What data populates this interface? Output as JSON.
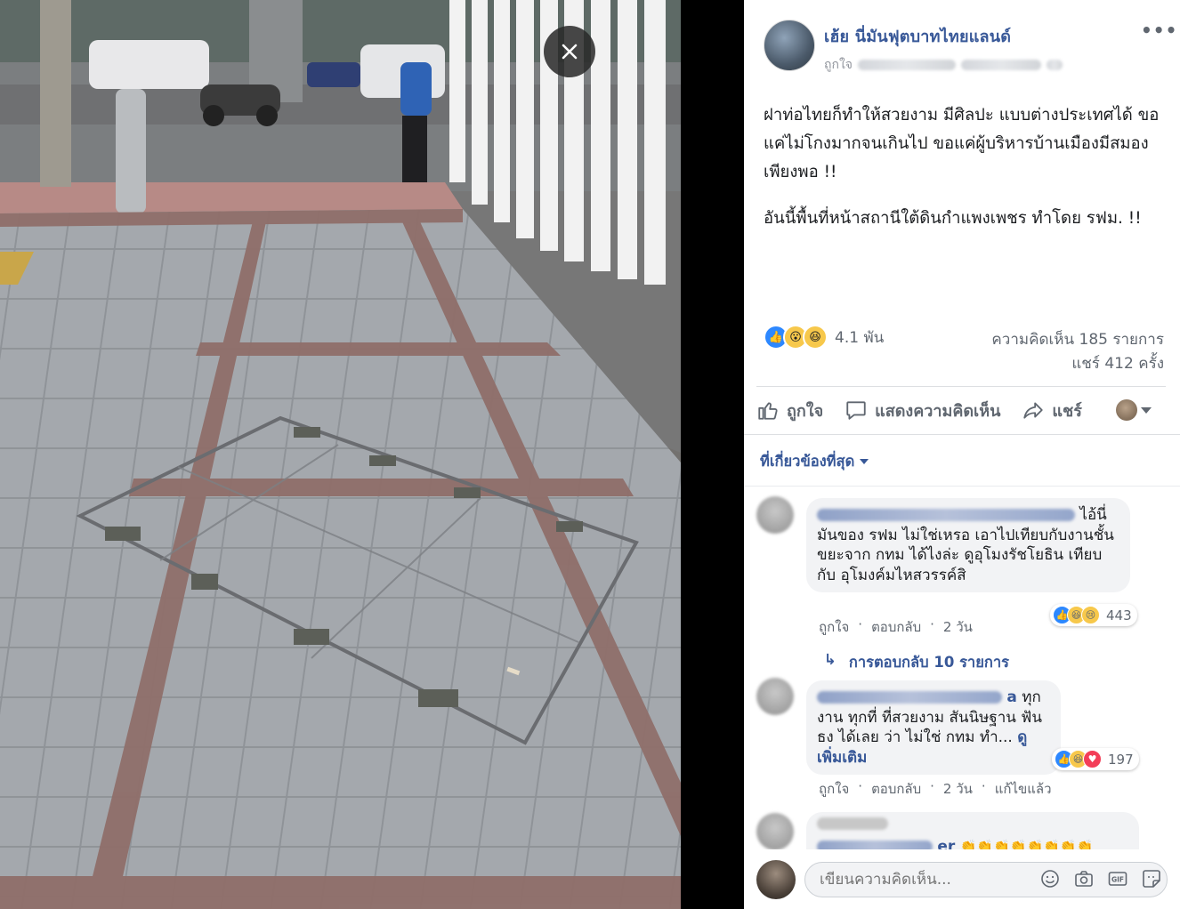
{
  "photo": {
    "close_icon": "close-icon"
  },
  "post": {
    "page_name": "เฮ้ย นี่มันฟุตบาทไทยแลนด์",
    "like_label": "ถูกใจ",
    "more_icon": "more-icon",
    "more_label": "•••",
    "text_paragraphs": [
      "ฝาท่อไทยก็ทำให้สวยงาม มีศิลปะ แบบต่างประเทศได้ ขอแค่ไม่โกงมากจนเกินไป ขอแค่ผู้บริหารบ้านเมืองมีสมองเพียงพอ !!",
      "อันนี้พื้นที่หน้าสถานีใต้ดินกำแพงเพชร ทำโดย รฟม. !!"
    ],
    "reaction_total": "4.1 พัน",
    "comment_count": "ความคิดเห็น 185 รายการ",
    "share_count": "แชร์ 412 ครั้ง"
  },
  "actions": {
    "like": "ถูกใจ",
    "comment": "แสดงความคิดเห็น",
    "share": "แชร์"
  },
  "sort": {
    "label": "ที่เกี่ยวข้องที่สุด"
  },
  "comments": [
    {
      "name_tail": "ไอ้นี่",
      "text": "มันของ รฟม ไม่ใช่เหรอ เอาไปเทียบกับงานชั้นขยะจาก กทม ได้ไงล่ะ ดูอุโมงรัชโยธิน เทียบกับ อุโมงค์มไหสวรรค์สิ",
      "like": "ถูกใจ",
      "reply": "ตอบกลับ",
      "time": "2 วัน",
      "reaction_count": "443",
      "replies": "การตอบกลับ 10 รายการ"
    },
    {
      "name_tail": "a",
      "text_lead": "ทุก",
      "text": "งาน ทุกที่ ที่สวยงาม สันนิษฐาน ฟันธง ได้เลย ว่า ไม่ใช่ กทม ทำ...",
      "see_more": "ดูเพิ่มเติม",
      "like": "ถูกใจ",
      "reply": "ตอบกลับ",
      "time": "2 วัน",
      "edited": "แก้ไขแล้ว",
      "reaction_count": "197"
    },
    {
      "name_tail": "er"
    }
  ],
  "composer": {
    "placeholder": "เขียนความคิดเห็น...",
    "icons": [
      "emoji-icon",
      "camera-icon",
      "gif-icon",
      "sticker-icon"
    ]
  },
  "colors": {
    "link": "#385898",
    "like_blue": "#2d88ff",
    "wow_yellow": "#f7c84b",
    "love_red": "#f33e58"
  }
}
